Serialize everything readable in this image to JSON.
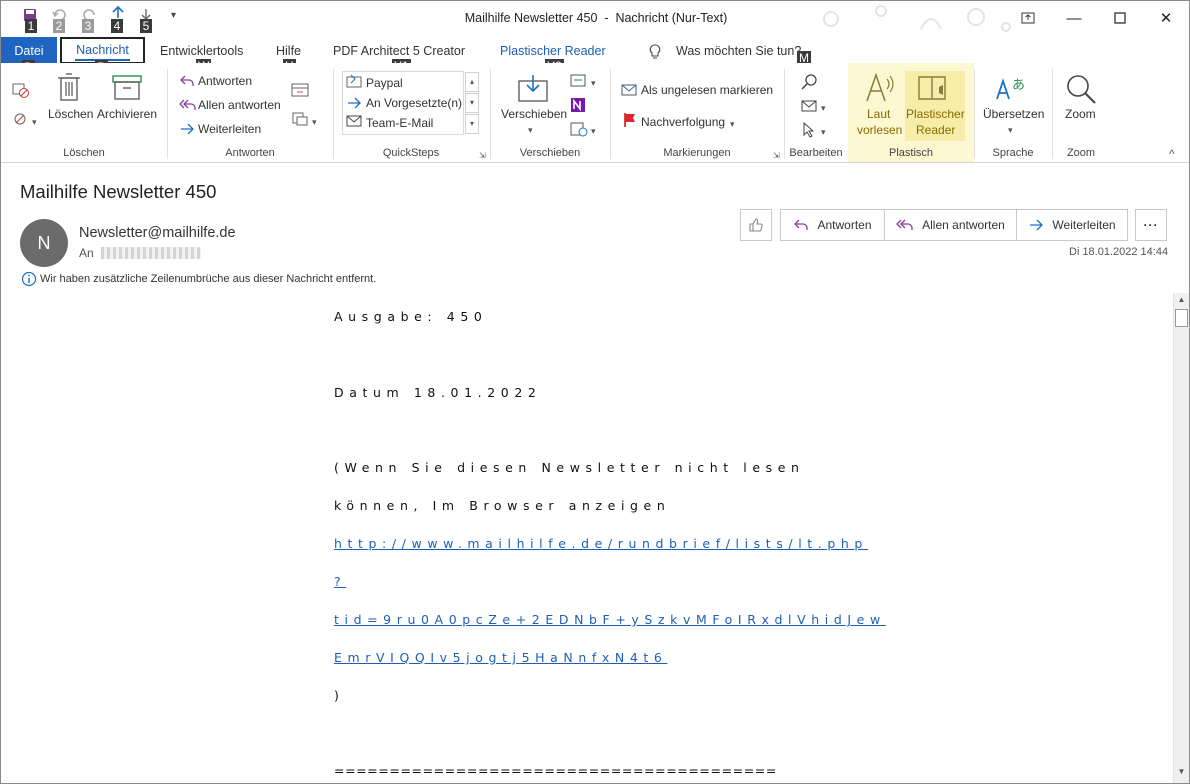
{
  "window": {
    "title": "Mailhilfe Newsletter 450  -  Nachricht (Nur-Text)"
  },
  "qat": {
    "keytips": [
      "1",
      "2",
      "3",
      "4",
      "5"
    ]
  },
  "menu": {
    "tabs": [
      {
        "label": "Datei"
      },
      {
        "label": "Nachricht"
      },
      {
        "label": "Entwicklertools"
      },
      {
        "label": "Hilfe"
      },
      {
        "label": "PDF Architect 5 Creator"
      },
      {
        "label": "Plastischer Reader"
      }
    ],
    "search": "Was möchten Sie tun?",
    "keytips": [
      "D",
      "R",
      "W",
      "H",
      "Y1",
      "Y2",
      "M"
    ]
  },
  "ribbon": {
    "delete": {
      "delete_label": "Löschen",
      "archive_label": "Archivieren",
      "group": "Löschen"
    },
    "respond": {
      "reply": "Antworten",
      "reply_all": "Allen antworten",
      "forward": "Weiterleiten",
      "group": "Antworten"
    },
    "quicksteps": {
      "items": [
        "Paypal",
        "An Vorgesetzte(n)",
        "Team-E-Mail"
      ],
      "group": "QuickSteps"
    },
    "move": {
      "move_label": "Verschieben",
      "group": "Verschieben"
    },
    "tags": {
      "unread": "Als ungelesen markieren",
      "followup": "Nachverfolgung",
      "group": "Markierungen"
    },
    "edit": {
      "group": "Bearbeiten"
    },
    "immersive": {
      "read_aloud_1": "Laut",
      "read_aloud_2": "vorlesen",
      "reader_1": "Plastischer",
      "reader_2": "Reader",
      "group": "Plastisch"
    },
    "language": {
      "translate": "Übersetzen",
      "group": "Sprache"
    },
    "zoom": {
      "label": "Zoom",
      "group": "Zoom"
    }
  },
  "message": {
    "subject": "Mailhilfe Newsletter 450",
    "avatar_initial": "N",
    "from": "Newsletter@mailhilfe.de",
    "to_label": "An",
    "info": "Wir haben zusätzliche Zeilenumbrüche aus dieser Nachricht entfernt.",
    "date": "Di 18.01.2022 14:44",
    "actions": {
      "reply": "Antworten",
      "reply_all": "Allen antworten",
      "forward": "Weiterleiten"
    }
  },
  "body": {
    "line1": "Ausgabe: 450",
    "line2": "Datum 18.01.2022",
    "line3": "(Wenn Sie diesen Newsletter nicht lesen",
    "line4": "können, Im Browser anzeigen",
    "link1": "http://www.mailhilfe.de/rundbrief/lists/lt.php",
    "link2": "?",
    "link3": "tid=9ru0A0pcZe+2EDNbF+ySzkvMFoIRxdlVhidJew",
    "link4": "EmrVIQQIv5jogtj5HaNnfxN4t6",
    "line5": ")",
    "rule": "========================================"
  }
}
